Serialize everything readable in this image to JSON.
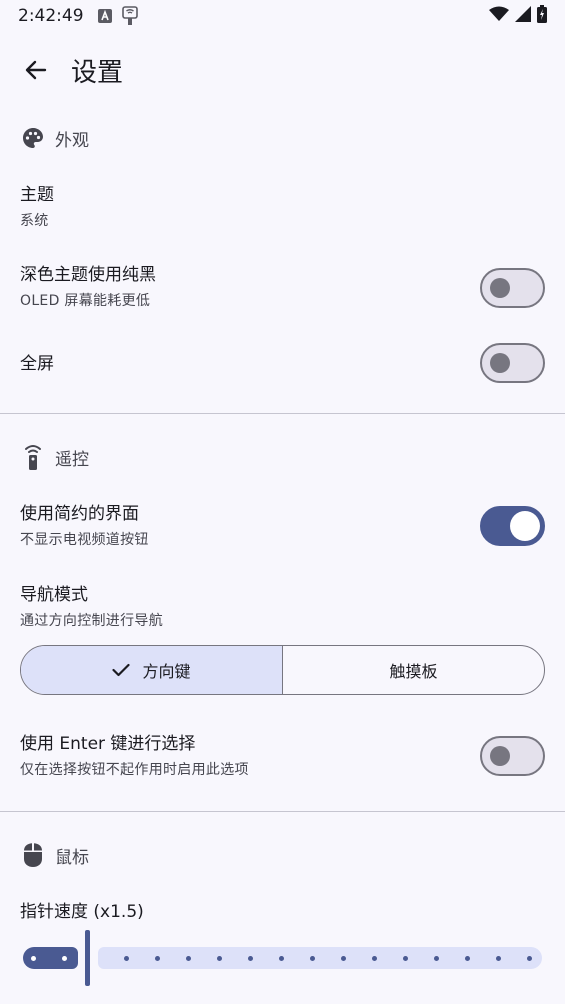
{
  "status": {
    "time": "2:42:49"
  },
  "header": {
    "title": "设置"
  },
  "sections": {
    "appearance": {
      "label": "外观"
    },
    "remote": {
      "label": "遥控"
    },
    "mouse": {
      "label": "鼠标"
    }
  },
  "theme": {
    "title": "主题",
    "value": "系统"
  },
  "pure_black": {
    "title": "深色主题使用纯黑",
    "subtitle": "OLED 屏幕能耗更低",
    "enabled": false
  },
  "fullscreen": {
    "title": "全屏",
    "enabled": false
  },
  "simple_ui": {
    "title": "使用简约的界面",
    "subtitle": "不显示电视频道按钮",
    "enabled": true
  },
  "nav_mode": {
    "title": "导航模式",
    "subtitle": "通过方向控制进行导航",
    "options": [
      "方向键",
      "触摸板"
    ],
    "selected": "方向键"
  },
  "enter_select": {
    "title": "使用 Enter 键进行选择",
    "subtitle": "仅在选择按钮不起作用时启用此选项",
    "enabled": false
  },
  "pointer_speed": {
    "title": "指针速度 (x1.5)",
    "value": 1.5
  },
  "colors": {
    "accent": "#4a5a92",
    "accent_container": "#dde1f9",
    "background": "#f8f7fd"
  }
}
